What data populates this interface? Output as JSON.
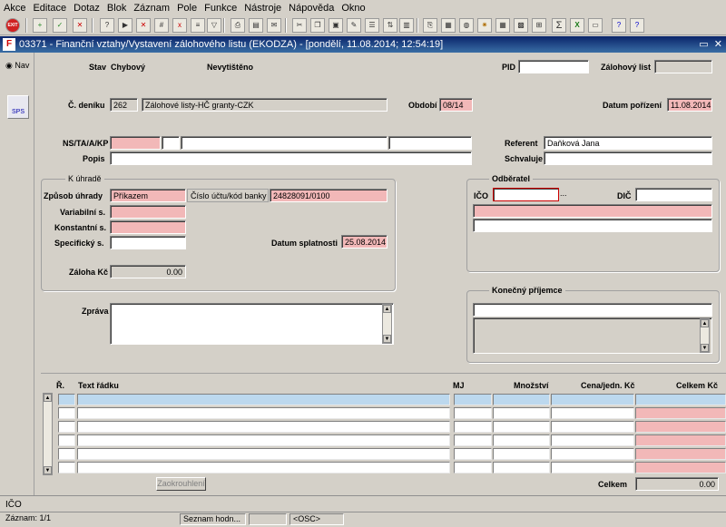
{
  "menu": [
    "Akce",
    "Editace",
    "Dotaz",
    "Blok",
    "Záznam",
    "Pole",
    "Funkce",
    "Nástroje",
    "Nápověda",
    "Okno"
  ],
  "toolbar": {
    "exit_label": "EXIT"
  },
  "window": {
    "title": "03371 - Finanční vztahy/Vystavení zálohového listu (EKODZA) - [pondělí, 11.08.2014; 12:54:19]",
    "logo": "F",
    "min_restore": "▭",
    "close": "✕"
  },
  "nav": {
    "label": "Nav",
    "sps_label": "SPS"
  },
  "header": {
    "stav_label": "Stav",
    "stav_value": "Chybový",
    "print_status": "Nevytištěno",
    "pid_label": "PID",
    "pid_value": "",
    "zalohovy_list_label": "Zálohový list",
    "zalohovy_list_value": "",
    "denik_label": "Č. deníku",
    "denik_code": "262",
    "denik_name": "Zálohové listy-HČ granty-CZK",
    "obdobi_label": "Období",
    "obdobi_value": "08/14",
    "datum_porizeni_label": "Datum pořízení",
    "datum_porizeni_value": "11.08.2014",
    "ns_label": "NS/TA/A/KP",
    "ns_values": [
      "",
      "",
      "",
      ""
    ],
    "referent_label": "Referent",
    "referent_value": "Daňková Jana",
    "popis_label": "Popis",
    "popis_value": "",
    "schvaluje_label": "Schvaluje",
    "schvaluje_value": ""
  },
  "uhrada": {
    "group_title": "K úhradě",
    "zpusob_label": "Způsob úhrady",
    "zpusob_value": "Příkazem",
    "ucet_label": "Číslo účtu/kód banky",
    "ucet_value": "24828091/0100",
    "variabilni_label": "Variabilní s.",
    "variabilni_value": "",
    "konstantni_label": "Konstantní s.",
    "konstantni_value": "",
    "specificky_label": "Specifický s.",
    "specificky_value": "",
    "splatnost_label": "Datum splatnosti",
    "splatnost_value": "25.08.2014",
    "zaloha_label": "Záloha Kč",
    "zaloha_value": "0.00"
  },
  "odberatel": {
    "group_title": "Odběratel",
    "ico_label": "IČO",
    "ico_value": "",
    "lookup": "...",
    "dic_label": "DIČ",
    "dic_value": "",
    "name": "",
    "address": ""
  },
  "prijemce": {
    "group_title": "Konečný příjemce",
    "name": "",
    "address": ""
  },
  "zprava": {
    "label": "Zpráva",
    "value": ""
  },
  "lines": {
    "columns": [
      "Ř.",
      "Text řádku",
      "MJ",
      "Množství",
      "Cena/jedn. Kč",
      "Celkem Kč"
    ],
    "rows": 6,
    "round_button": "Zaokrouhlení",
    "total_label": "Celkem",
    "total_value": "0.00"
  },
  "status": {
    "field_label": "IČO",
    "record": "Záznam: 1/1",
    "list": "Seznam hodn...",
    "osc": "<OSC>"
  }
}
